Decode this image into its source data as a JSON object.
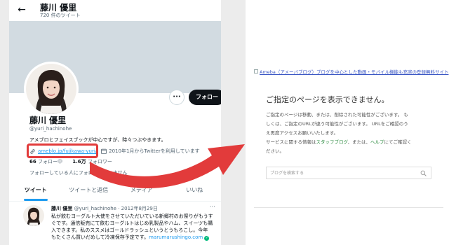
{
  "twitter": {
    "header": {
      "name": "藤川 優里",
      "tweet_count": "720 件のツイート"
    },
    "profile": {
      "name": "藤川 優里",
      "handle": "@yuri_hachinohe",
      "bio": "アメブロとフェイスブックが中心ですが、時々つぶやきます。",
      "link": "ameblo.jp/fujikawa-yuri/",
      "joined": "2010年1月からTwitterを利用しています",
      "following_count": "66",
      "following_label": "フォロー中",
      "followers_count": "1.6万",
      "followers_label": "フォロワー",
      "follow_note": "フォローしている人にフォロワーはいません",
      "follow_button": "フォロー",
      "more_button": "···"
    },
    "tabs": [
      "ツイート",
      "ツイートと返信",
      "メディア",
      "いいね"
    ],
    "tweet": {
      "name": "藤川 優里",
      "handle_date": "@yuri_hachinohe · 2012年8月29日",
      "more": "···",
      "lines": [
        "私が飲むヨーグルト大使をさせていただいている新郷村のお祭りがもうす",
        "ぐです。通信販売にて飲むヨーグルトはじめ乳製品やハム、スイーツも購",
        "入できます。私のススメはゴールドラッシュというとうもろこし。今年",
        "もたくさん買いだめして冷凍保存予定です。"
      ],
      "link": "marumarushingo.com"
    }
  },
  "ameba": {
    "banner_text": "Ameba（アメーバブログ）ブログを中心とした動画・モバイル機能も充実の登録無料サイト",
    "title": "ご指定のページを表示できません。",
    "paragraph_lines": [
      "ご指定のページは移動、または、削除された可能性がございます。 も",
      "しくは、ご指定のURLが違う可能性がございます。 URLをご確認のう",
      "え再度アクセスお願いいたします。"
    ],
    "service_prefix": "サービスに関する情報は",
    "service_link1": "スタッフブログ",
    "service_mid": "、または、",
    "service_link2": "ヘルプ",
    "service_suffix": "にてご確認く",
    "service_line2": "ださい。",
    "search_placeholder": "ブログを検索する"
  },
  "colors": {
    "link_blue": "#1d9bf0",
    "highlight_red": "#e23b3b",
    "arrow_red": "#e23b3b",
    "ameba_link_green": "#2a8a3e"
  },
  "icons": [
    "back-arrow-icon",
    "link-icon",
    "calendar-icon",
    "search-icon",
    "verified-check-icon"
  ]
}
